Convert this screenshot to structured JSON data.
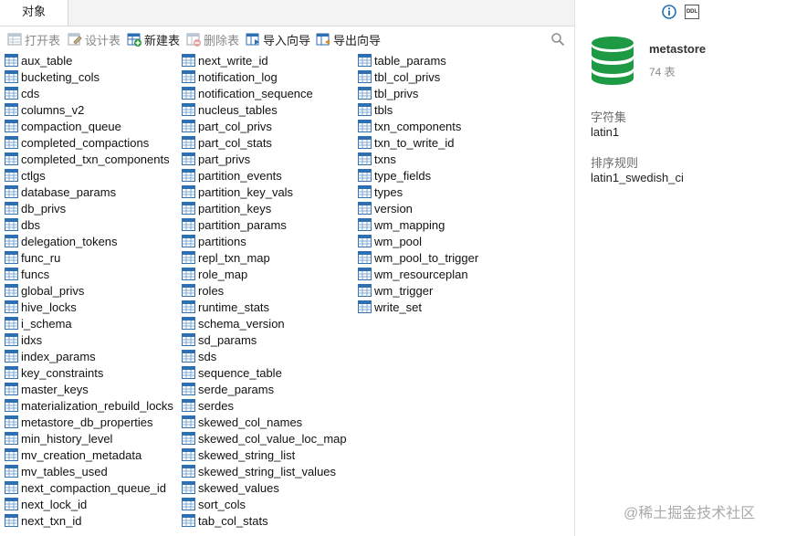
{
  "tab": {
    "label": "对象"
  },
  "toolbar": {
    "open": "打开表",
    "design": "设计表",
    "new": "新建表",
    "delete": "删除表",
    "import": "导入向导",
    "export": "导出向导"
  },
  "columns": [
    [
      "aux_table",
      "bucketing_cols",
      "cds",
      "columns_v2",
      "compaction_queue",
      "completed_compactions",
      "completed_txn_components",
      "ctlgs",
      "database_params",
      "db_privs",
      "dbs",
      "delegation_tokens",
      "func_ru",
      "funcs",
      "global_privs",
      "hive_locks",
      "i_schema",
      "idxs",
      "index_params",
      "key_constraints",
      "master_keys",
      "materialization_rebuild_locks",
      "metastore_db_properties",
      "min_history_level",
      "mv_creation_metadata",
      "mv_tables_used",
      "next_compaction_queue_id",
      "next_lock_id",
      "next_txn_id"
    ],
    [
      "next_write_id",
      "notification_log",
      "notification_sequence",
      "nucleus_tables",
      "part_col_privs",
      "part_col_stats",
      "part_privs",
      "partition_events",
      "partition_key_vals",
      "partition_keys",
      "partition_params",
      "partitions",
      "repl_txn_map",
      "role_map",
      "roles",
      "runtime_stats",
      "schema_version",
      "sd_params",
      "sds",
      "sequence_table",
      "serde_params",
      "serdes",
      "skewed_col_names",
      "skewed_col_value_loc_map",
      "skewed_string_list",
      "skewed_string_list_values",
      "skewed_values",
      "sort_cols",
      "tab_col_stats"
    ],
    [
      "table_params",
      "tbl_col_privs",
      "tbl_privs",
      "tbls",
      "txn_components",
      "txn_to_write_id",
      "txns",
      "type_fields",
      "types",
      "version",
      "wm_mapping",
      "wm_pool",
      "wm_pool_to_trigger",
      "wm_resourceplan",
      "wm_trigger",
      "write_set"
    ]
  ],
  "info": {
    "db_name": "metastore",
    "table_count": "74 表",
    "charset_label": "字符集",
    "charset_value": "latin1",
    "collation_label": "排序规则",
    "collation_value": "latin1_swedish_ci",
    "ddl_icon_text": "DDL"
  },
  "watermark": "@稀土掘金技术社区",
  "colors": {
    "accent_blue": "#1f6fb2",
    "db_green": "#1e9a44"
  }
}
